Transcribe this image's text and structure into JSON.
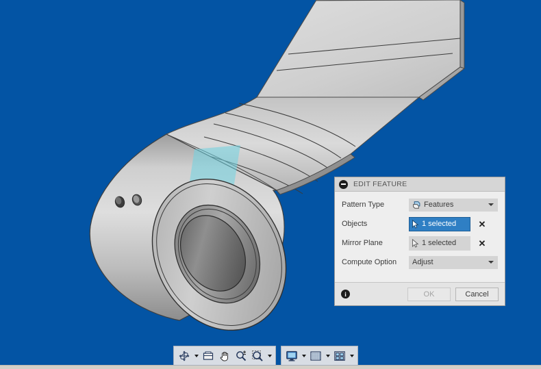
{
  "app": {
    "viewport_background": "#0354a4",
    "model_color": "#b7b7b7",
    "plane_color": "#7fd6e0"
  },
  "dialog": {
    "title": "EDIT FEATURE",
    "collapse_icon": "minus-circle-icon",
    "rows": [
      {
        "label": "Pattern Type",
        "kind": "combo",
        "value": "Features",
        "icon": "features-pattern-icon",
        "arrow_icon": "chevron-down-icon"
      },
      {
        "label": "Objects",
        "kind": "select",
        "value": "1 selected",
        "icon": "cursor-arrow-icon",
        "active": true,
        "clear_icon": "close-x-icon",
        "clear_label": "✕"
      },
      {
        "label": "Mirror Plane",
        "kind": "select",
        "value": "1 selected",
        "icon": "cursor-arrow-icon",
        "active": false,
        "clear_icon": "close-x-icon",
        "clear_label": "✕"
      },
      {
        "label": "Compute Option",
        "kind": "combo",
        "value": "Adjust",
        "icon": null,
        "arrow_icon": "chevron-down-icon"
      }
    ],
    "footer": {
      "info_icon": "info-icon",
      "info_glyph": "i",
      "ok_label": "OK",
      "ok_disabled": true,
      "cancel_label": "Cancel"
    }
  },
  "view_toolbar": {
    "groups": [
      {
        "name": "navigation-group",
        "buttons": [
          {
            "name": "rotate-icon",
            "has_arrow": true
          },
          {
            "name": "fit-view-icon",
            "has_arrow": false
          },
          {
            "name": "pan-hand-icon",
            "has_arrow": false
          },
          {
            "name": "zoom-in-out-icon",
            "has_arrow": false
          },
          {
            "name": "zoom-window-icon",
            "has_arrow": true
          }
        ]
      },
      {
        "name": "display-group",
        "buttons": [
          {
            "name": "render-style-icon",
            "has_arrow": true
          },
          {
            "name": "grid-icon",
            "has_arrow": true
          },
          {
            "name": "layout-icon",
            "has_arrow": true
          }
        ]
      }
    ]
  }
}
